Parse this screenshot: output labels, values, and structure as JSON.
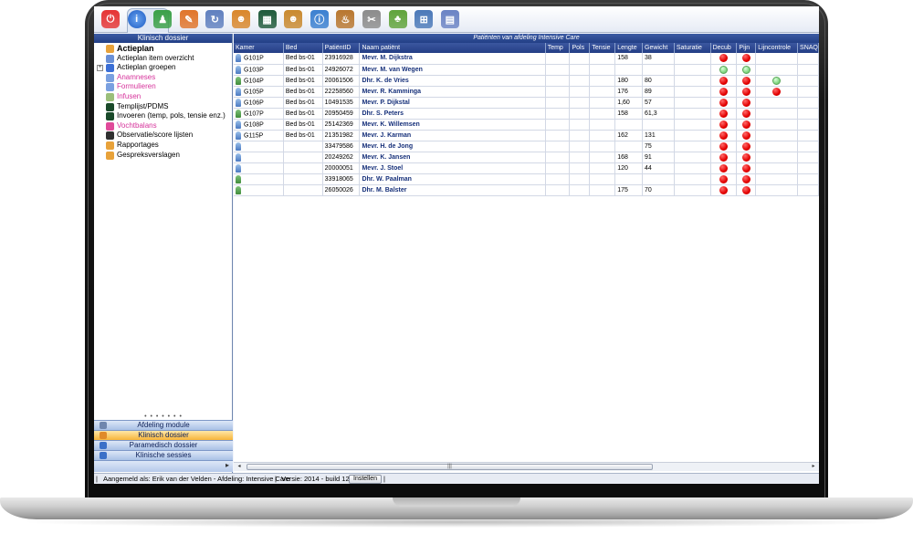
{
  "toolbar": {
    "icons": [
      "power-icon",
      "info-icon",
      "person-icon",
      "book-icon",
      "refresh-icon",
      "users-icon",
      "monitor-icon",
      "doctor-icon",
      "info-user-icon",
      "chef-icon",
      "clip-icon",
      "tree-icon",
      "network-icon",
      "folder-icon"
    ]
  },
  "left_panel": {
    "title": "Klinisch dossier",
    "items": [
      {
        "label": "Actieplan",
        "style": "bold"
      },
      {
        "label": "Actieplan item overzicht",
        "style": "normal"
      },
      {
        "label": "Actieplan groepen",
        "style": "normal",
        "expander": "+"
      },
      {
        "label": "Anamneses",
        "style": "pink"
      },
      {
        "label": "Formulieren",
        "style": "pink"
      },
      {
        "label": "Infusen",
        "style": "pink"
      },
      {
        "label": "Templijst/PDMS",
        "style": "normal"
      },
      {
        "label": "Invoeren (temp, pols, tensie enz.)",
        "style": "normal"
      },
      {
        "label": "Vochtbalans",
        "style": "pink"
      },
      {
        "label": "Observatie/score lijsten",
        "style": "normal"
      },
      {
        "label": "Rapportages",
        "style": "normal"
      },
      {
        "label": "Gespreksverslagen",
        "style": "normal"
      }
    ],
    "nav": [
      {
        "label": "Afdeling module",
        "active": false
      },
      {
        "label": "Klinisch dossier",
        "active": true
      },
      {
        "label": "Paramedisch dossier",
        "active": false
      },
      {
        "label": "Klinische sessies",
        "active": false
      }
    ]
  },
  "grid": {
    "title": "Patiënten van afdeling Intensive Care",
    "columns": [
      "Kamer",
      "Bed",
      "PatiëntID",
      "Naam patiënt",
      "Temp",
      "Pols",
      "Tensie",
      "Lengte",
      "Gewicht",
      "Saturatie",
      "Decub",
      "Pijn",
      "Lijncontrole",
      "SNAQ"
    ],
    "rows": [
      {
        "gender": "f",
        "kamer": "G101P",
        "bed": "Bed bs-01",
        "id": "23916928",
        "naam": "Mevr. M. Dijkstra",
        "lengte": "158",
        "gewicht": "38",
        "decub": "red",
        "pijn": "red",
        "lijn": ""
      },
      {
        "gender": "f",
        "kamer": "G103P",
        "bed": "Bed bs-01",
        "id": "24926072",
        "naam": "Mevr. M. van Wegen",
        "lengte": "",
        "gewicht": "",
        "decub": "green",
        "pijn": "green",
        "lijn": ""
      },
      {
        "gender": "m",
        "kamer": "G104P",
        "bed": "Bed bs-01",
        "id": "20061506",
        "naam": "Dhr. K. de Vries",
        "lengte": "180",
        "gewicht": "80",
        "decub": "red",
        "pijn": "red",
        "lijn": "green"
      },
      {
        "gender": "f",
        "kamer": "G105P",
        "bed": "Bed bs-01",
        "id": "22258560",
        "naam": "Mevr. R. Kamminga",
        "lengte": "176",
        "gewicht": "89",
        "decub": "red",
        "pijn": "red",
        "lijn": "red"
      },
      {
        "gender": "f",
        "kamer": "G106P",
        "bed": "Bed bs-01",
        "id": "10491535",
        "naam": "Mevr. P. Dijkstal",
        "lengte": "1,60",
        "gewicht": "57",
        "decub": "red",
        "pijn": "red",
        "lijn": ""
      },
      {
        "gender": "m",
        "kamer": "G107P",
        "bed": "Bed bs-01",
        "id": "20950459",
        "naam": "Dhr. S. Peters",
        "lengte": "158",
        "gewicht": "61,3",
        "decub": "red",
        "pijn": "red",
        "lijn": ""
      },
      {
        "gender": "f",
        "kamer": "G108P",
        "bed": "Bed bs-01",
        "id": "25142369",
        "naam": "Mevr. K. Willemsen",
        "lengte": "",
        "gewicht": "",
        "decub": "red",
        "pijn": "red",
        "lijn": ""
      },
      {
        "gender": "f",
        "kamer": "G115P",
        "bed": "Bed bs-01",
        "id": "21351982",
        "naam": "Mevr. J. Karman",
        "lengte": "162",
        "gewicht": "131",
        "decub": "red",
        "pijn": "red",
        "lijn": ""
      },
      {
        "gender": "f",
        "kamer": "",
        "bed": "",
        "id": "33479586",
        "naam": "Mevr. H. de Jong",
        "lengte": "",
        "gewicht": "75",
        "decub": "red",
        "pijn": "red",
        "lijn": ""
      },
      {
        "gender": "f",
        "kamer": "",
        "bed": "",
        "id": "20249262",
        "naam": "Mevr.  K. Jansen",
        "lengte": "168",
        "gewicht": "91",
        "decub": "red",
        "pijn": "red",
        "lijn": ""
      },
      {
        "gender": "f",
        "kamer": "",
        "bed": "",
        "id": "20000051",
        "naam": "Mevr. J. Stoel",
        "lengte": "120",
        "gewicht": "44",
        "decub": "red",
        "pijn": "red",
        "lijn": ""
      },
      {
        "gender": "m",
        "kamer": "",
        "bed": "",
        "id": "33918065",
        "naam": "Dhr. W. Paalman",
        "lengte": "",
        "gewicht": "",
        "decub": "red",
        "pijn": "red",
        "lijn": ""
      },
      {
        "gender": "m",
        "kamer": "",
        "bed": "",
        "id": "26050026",
        "naam": "Dhr. M. Balster",
        "lengte": "175",
        "gewicht": "70",
        "decub": "red",
        "pijn": "red",
        "lijn": ""
      }
    ]
  },
  "status": {
    "user": "Aangemeld als: Erik van der Velden - Afdeling: Intensive Care",
    "version": "Versie: 2014 - build 12",
    "button": "Instellen"
  },
  "colors": {
    "header": "#243e85",
    "accent": "#f7b53a",
    "pink": "#d6339b",
    "red": "#e30000",
    "green": "#86d986"
  }
}
